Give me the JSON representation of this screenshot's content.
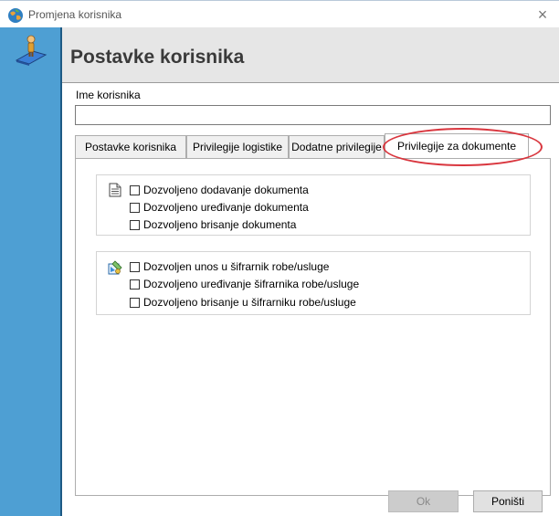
{
  "window": {
    "title": "Promjena korisnika",
    "close_glyph": "×"
  },
  "header": {
    "title": "Postavke korisnika"
  },
  "form": {
    "ime_label": "Ime korisnika",
    "ime_value": ""
  },
  "tabs": [
    {
      "label": "Postavke korisnika"
    },
    {
      "label": "Privilegije logistike"
    },
    {
      "label": "Dodatne privilegije"
    },
    {
      "label": "Privilegije za dokumente"
    }
  ],
  "active_tab": 3,
  "groups": {
    "documents": {
      "icon": "document-icon",
      "items": [
        {
          "label": "Dozvoljeno dodavanje dokumenta",
          "checked": false
        },
        {
          "label": "Dozvoljeno uređivanje dokumenta",
          "checked": false
        },
        {
          "label": "Dozvoljeno brisanje dokumenta",
          "checked": false
        }
      ]
    },
    "catalog": {
      "icon": "catalog-edit-icon",
      "items": [
        {
          "label": "Dozvoljen unos u šifrarnik robe/usluge",
          "checked": false
        },
        {
          "label": "Dozvoljeno uređivanje šifrarnika robe/usluge",
          "checked": false
        },
        {
          "label": "Dozvoljeno brisanje u šifrarniku robe/usluge",
          "checked": false
        }
      ]
    }
  },
  "buttons": {
    "ok": "Ok",
    "cancel": "Poništi"
  },
  "colors": {
    "strip": "#4e9fd3",
    "header_bg": "#e6e6e6",
    "annotation": "#d9363e"
  }
}
